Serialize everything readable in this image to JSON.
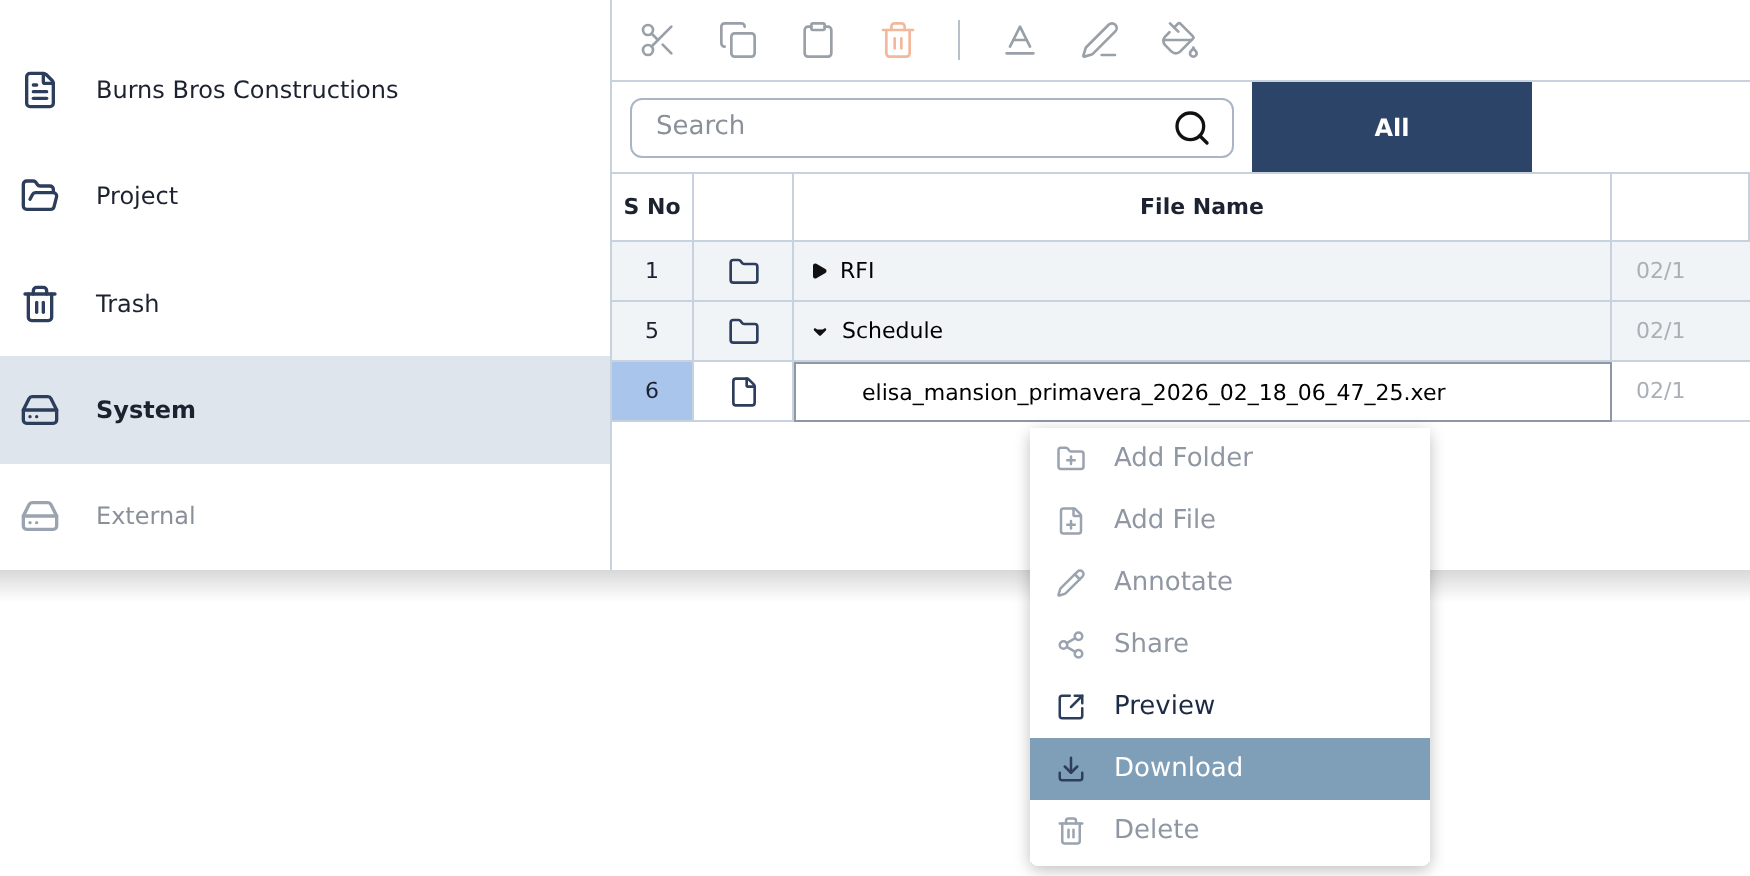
{
  "sidebar": {
    "items": [
      {
        "label": "Burns Bros Constructions",
        "kind": "company",
        "selected": false,
        "disabled": false
      },
      {
        "label": "Project",
        "kind": "folder",
        "selected": false,
        "disabled": false
      },
      {
        "label": "Trash",
        "kind": "trash",
        "selected": false,
        "disabled": false
      },
      {
        "label": "System",
        "kind": "drive",
        "selected": true,
        "disabled": false
      },
      {
        "label": "External",
        "kind": "cloud",
        "selected": false,
        "disabled": true
      }
    ]
  },
  "toolbar": {
    "tools": [
      {
        "kind": "cut",
        "disabled": true
      },
      {
        "kind": "copy",
        "disabled": true
      },
      {
        "kind": "paste",
        "disabled": true
      },
      {
        "kind": "delete",
        "disabled": true
      },
      {
        "kind": "separator"
      },
      {
        "kind": "text",
        "disabled": true
      },
      {
        "kind": "edit",
        "disabled": true
      },
      {
        "kind": "fill",
        "disabled": true
      }
    ]
  },
  "search": {
    "placeholder": "Search"
  },
  "filter_button": {
    "label": "All"
  },
  "table": {
    "columns": [
      "S No",
      "",
      "File Name"
    ],
    "rows": [
      {
        "sno": "1",
        "kind": "folder",
        "name": "RFI",
        "expanded": false,
        "selected": false,
        "date": "02/1"
      },
      {
        "sno": "5",
        "kind": "folder",
        "name": "Schedule",
        "expanded": true,
        "selected": false,
        "date": "02/1"
      },
      {
        "sno": "6",
        "kind": "file",
        "name": "elisa_mansion_primavera_2026_02_18_06_47_25.xer",
        "selected": true,
        "date": "02/1"
      }
    ]
  },
  "context_menu": {
    "items": [
      {
        "label": "Add Folder",
        "kind": "add-folder",
        "disabled": true,
        "selected": false
      },
      {
        "label": "Add File",
        "kind": "add-file",
        "disabled": true,
        "selected": false
      },
      {
        "label": "Annotate",
        "kind": "annotate",
        "disabled": true,
        "selected": false
      },
      {
        "label": "Share",
        "kind": "share",
        "disabled": true,
        "selected": false
      },
      {
        "label": "Preview",
        "kind": "preview",
        "disabled": false,
        "selected": false
      },
      {
        "label": "Download",
        "kind": "download",
        "disabled": false,
        "selected": true
      },
      {
        "label": "Delete",
        "kind": "delete",
        "disabled": true,
        "selected": false
      }
    ]
  }
}
